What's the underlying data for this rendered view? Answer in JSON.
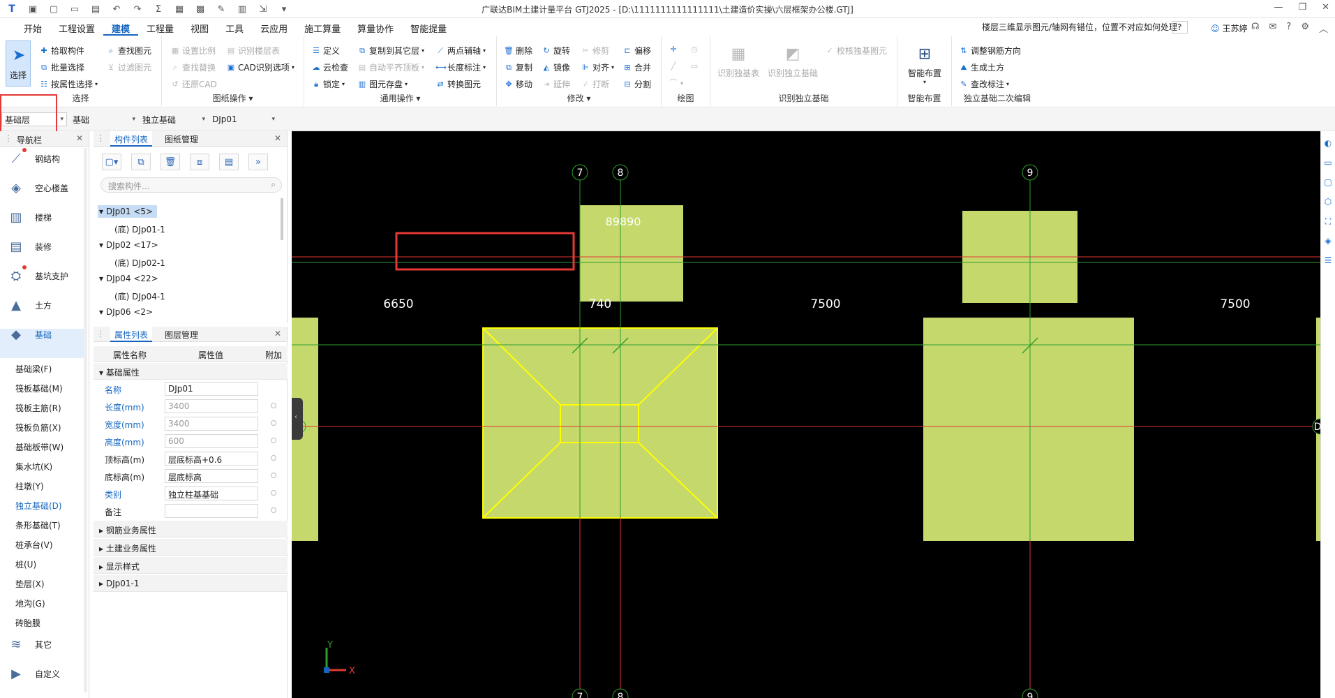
{
  "app": {
    "title": "广联达BIM土建计量平台 GTJ2025 - [D:\\1111111111111111\\土建造价实操\\六层框架办公楼.GTJ]"
  },
  "menu": {
    "tabs": [
      "开始",
      "工程设置",
      "建模",
      "工程量",
      "视图",
      "工具",
      "云应用",
      "施工算量",
      "算量协作",
      "智能提量"
    ],
    "help_text": "楼层三维显示图元/轴网有错位，位置不对应如何处理?",
    "user": "王苏婷"
  },
  "ribbon": {
    "select_group": {
      "select": "选择",
      "pick": "拾取构件",
      "batch": "批量选择",
      "by_attr": "按属性选择",
      "find": "查找图元",
      "filter": "过滤图元",
      "label": "选择"
    },
    "drawing_group": {
      "scale": "设置比例",
      "find_replace": "查找替换",
      "restore_cad": "还原CAD",
      "identify_floor": "识别楼层表",
      "cad_option": "CAD识别选项",
      "label": "图纸操作"
    },
    "general_group": {
      "define": "定义",
      "cloud_check": "云检查",
      "lock": "锁定",
      "copy_to": "复制到其它层",
      "auto_level": "自动平齐顶板",
      "store": "图元存盘",
      "two_point": "两点辅轴",
      "dim": "长度标注",
      "convert": "转换图元",
      "label": "通用操作"
    },
    "modify_group": {
      "delete": "删除",
      "copy": "复制",
      "move": "移动",
      "rotate": "旋转",
      "mirror": "镜像",
      "extend": "延伸",
      "trim": "修剪",
      "align": "对齐",
      "break": "打断",
      "offset": "偏移",
      "merge": "合并",
      "split": "分割",
      "label": "修改"
    },
    "draw_group": {
      "label": "绘图"
    },
    "identify_group": {
      "table": "识别独基表",
      "identify": "识别独立基础",
      "check": "校核独基图元",
      "label": "识别独立基础"
    },
    "smart_group": {
      "smart": "智能布置",
      "label": "智能布置"
    },
    "edit_group": {
      "adjust": "调整钢筋方向",
      "earth": "生成土方",
      "mark": "查改标注",
      "label": "独立基础二次编辑"
    }
  },
  "layerbar": {
    "floor": "基础层",
    "category": "基础",
    "type": "独立基础",
    "component": "DJp01"
  },
  "nav": {
    "title": "导航栏",
    "items": [
      {
        "label": "钢结构",
        "icon": "steel-icon",
        "dot": true
      },
      {
        "label": "空心楼盖",
        "icon": "hollow-slab-icon",
        "dot": false
      },
      {
        "label": "楼梯",
        "icon": "stairs-icon",
        "dot": false
      },
      {
        "label": "装修",
        "icon": "decoration-icon",
        "dot": false
      },
      {
        "label": "基坑支护",
        "icon": "pit-support-icon",
        "dot": true
      },
      {
        "label": "土方",
        "icon": "earthwork-icon",
        "dot": false
      },
      {
        "label": "基础",
        "icon": "foundation-icon",
        "dot": false
      }
    ],
    "subitems": [
      "基础梁(F)",
      "筏板基础(M)",
      "筏板主筋(R)",
      "筏板负筋(X)",
      "基础板带(W)",
      "集水坑(K)",
      "柱墩(Y)",
      "独立基础(D)",
      "条形基础(T)",
      "桩承台(V)",
      "桩(U)",
      "垫层(X)",
      "地沟(G)",
      "砖胎膜"
    ],
    "bottom": [
      {
        "label": "其它",
        "icon": "other-icon"
      },
      {
        "label": "自定义",
        "icon": "custom-icon"
      }
    ]
  },
  "complist": {
    "tabs": [
      "构件列表",
      "图纸管理"
    ],
    "search_placeholder": "搜索构件...",
    "tree": [
      {
        "text": "DJp01 <5>",
        "level": 0,
        "sel": true
      },
      {
        "text": "(底) DJp01-1",
        "level": 1
      },
      {
        "text": "DJp02 <17>",
        "level": 0
      },
      {
        "text": "(底) DJp02-1",
        "level": 1
      },
      {
        "text": "DJp04 <22>",
        "level": 0
      },
      {
        "text": "(底) DJp04-1",
        "level": 1
      },
      {
        "text": "DJp06 <2>",
        "level": 0
      }
    ]
  },
  "props": {
    "tabs": [
      "属性列表",
      "图层管理"
    ],
    "headers": [
      "属性名称",
      "属性值",
      "附加"
    ],
    "section": "基础属性",
    "rows": [
      {
        "k": "名称",
        "v": "DJp01",
        "blue": true,
        "dis": false,
        "check": false
      },
      {
        "k": "长度(mm)",
        "v": "3400",
        "blue": true,
        "dis": true,
        "check": true
      },
      {
        "k": "宽度(mm)",
        "v": "3400",
        "blue": true,
        "dis": true,
        "check": true
      },
      {
        "k": "高度(mm)",
        "v": "600",
        "blue": true,
        "dis": true,
        "check": true
      },
      {
        "k": "顶标高(m)",
        "v": "层底标高+0.6",
        "blue": false,
        "dis": false,
        "check": true
      },
      {
        "k": "底标高(m)",
        "v": "层底标高",
        "blue": false,
        "dis": false,
        "check": true
      },
      {
        "k": "类别",
        "v": "独立柱基基础",
        "blue": true,
        "dis": false,
        "check": true
      },
      {
        "k": "备注",
        "v": "",
        "blue": false,
        "dis": false,
        "check": true
      }
    ],
    "sections": [
      "钢筋业务属性",
      "土建业务属性",
      "显示样式",
      "DJp01-1"
    ]
  },
  "canvas": {
    "axes_top": [
      "7",
      "8",
      "9"
    ],
    "dims": [
      "6650",
      "740",
      "7500",
      "7500"
    ],
    "label_89890": "89890",
    "right_axis": "D",
    "ucs_x": "X",
    "ucs_y": "Y"
  },
  "colors": {
    "accent": "#1565c0",
    "footing": "#c4d86c",
    "axis_red": "#e53935",
    "axis_green": "#2e9e2e",
    "highlight": "#e53935",
    "select_yellow": "#ffff00"
  }
}
